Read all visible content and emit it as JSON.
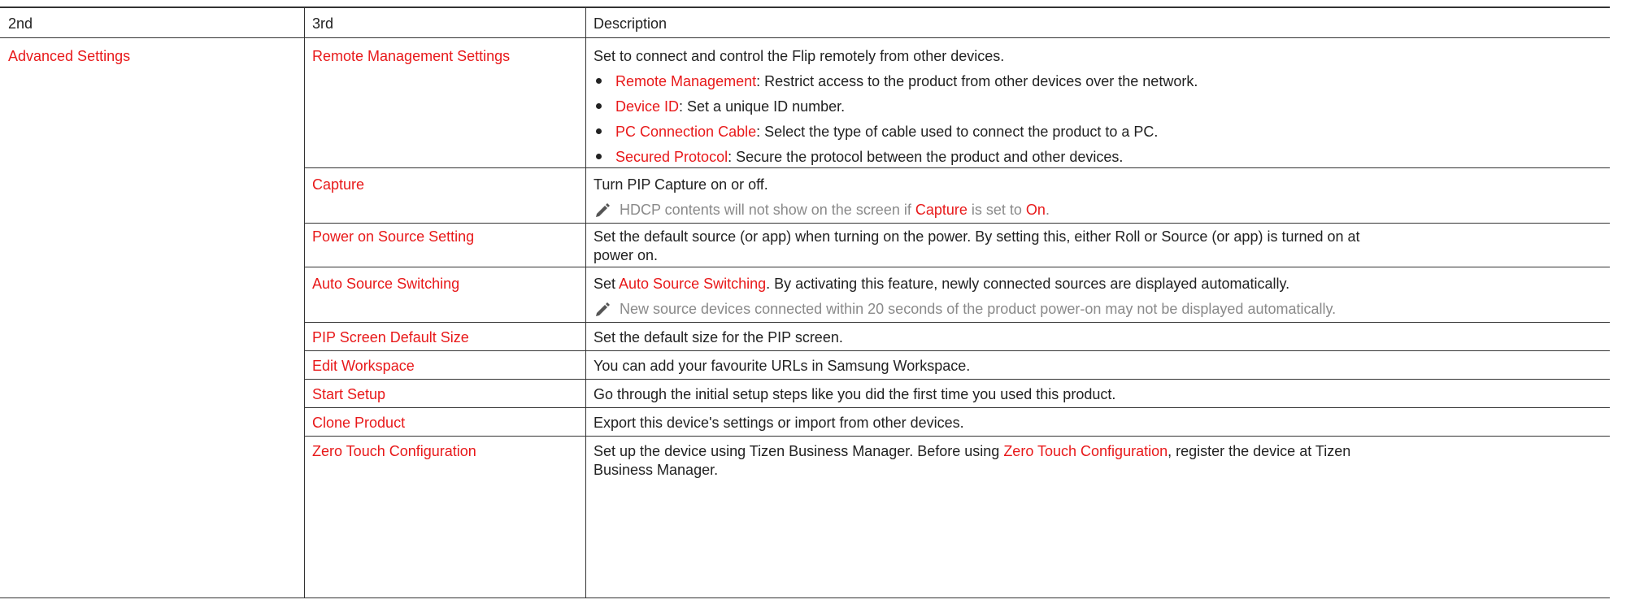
{
  "header": {
    "col1": "2nd",
    "col2": "3rd",
    "col3": "Description"
  },
  "second_level": "Advanced Settings",
  "rows": [
    {
      "name": "Remote Management Settings",
      "desc": "Set to connect and control the Flip remotely from other devices.",
      "bullets": [
        {
          "term": "Remote Management",
          "text": ": Restrict access to the product from other devices over the network."
        },
        {
          "term": "Device ID",
          "text": ": Set a unique ID number."
        },
        {
          "term": "PC Connection Cable",
          "text": ": Select the type of cable used to connect the product to a PC."
        },
        {
          "term": "Secured Protocol",
          "text": ": Secure the protocol between the product and other devices."
        }
      ]
    },
    {
      "name": "Capture",
      "desc": "Turn PIP Capture on or off.",
      "note": {
        "pre": "HDCP contents will not show on the screen if ",
        "term1": "Capture",
        "mid": " is set to ",
        "term2": "On",
        "post": "."
      }
    },
    {
      "name": "Power on Source Setting",
      "desc_line1": "Set the default source (or app) when turning on the power. By setting this, either Roll or Source (or app) is turned on at",
      "desc_line2": "power on."
    },
    {
      "name": "Auto Source Switching",
      "desc_pre": "Set ",
      "desc_term": "Auto Source Switching",
      "desc_post": ". By activating this feature, newly connected sources are displayed automatically.",
      "note": "New source devices connected within 20 seconds of the product power-on may not be displayed automatically."
    },
    {
      "name": "PIP Screen Default Size",
      "desc": "Set the default size for the PIP screen."
    },
    {
      "name": "Edit Workspace",
      "desc": "You can add your favourite URLs in Samsung Workspace."
    },
    {
      "name": "Start Setup",
      "desc": "Go through the initial setup steps like you did the first time you used this product."
    },
    {
      "name": "Clone Product",
      "desc": "Export this device's settings or import from other devices."
    },
    {
      "name": "Zero Touch Configuration",
      "desc_pre": "Set up the device using Tizen Business Manager. Before using ",
      "desc_term": "Zero Touch Configuration",
      "desc_post": ", register the device at Tizen",
      "desc_line2": "Business Manager."
    }
  ],
  "colors": {
    "term": "#e8191a",
    "text": "#222222",
    "note": "#8a8a8a",
    "rule": "#333333"
  },
  "icons": {
    "bullet": "bullet-dot-icon",
    "note": "pencil-note-icon"
  }
}
